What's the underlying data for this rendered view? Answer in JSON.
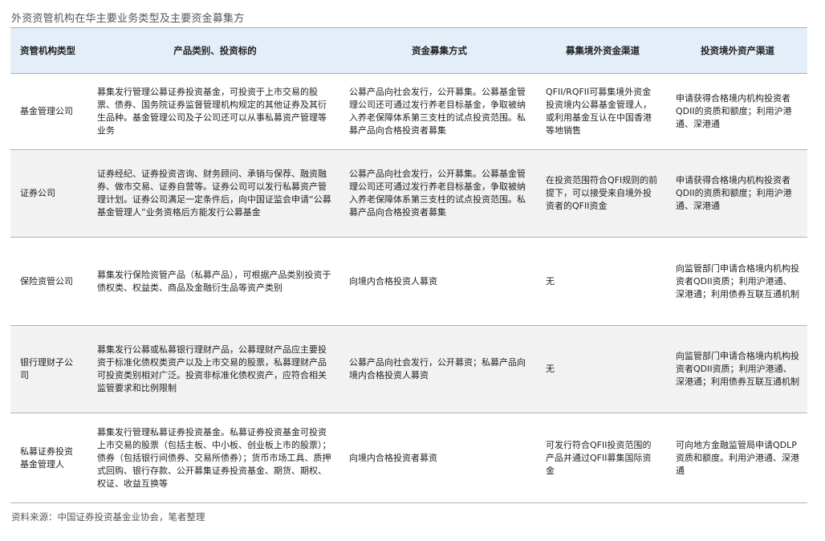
{
  "title": "外资资管机构在华主要业务类型及主要资金募集方",
  "headers": [
    "资管机构类型",
    "产品类别、投资标的",
    "资金募集方式",
    "募集境外资金渠道",
    "投资境外资产渠道"
  ],
  "rows": [
    {
      "type": "基金管理公司",
      "products": "募集发行管理公募证券投资基金，可投资于上市交易的股票、债券、国务院证券监督管理机构规定的其他证券及其衍生品种。基金管理公司及子公司还可以从事私募资产管理等业务",
      "fundraising": "公募产品向社会发行，公开募集。公募基金管理公司还可通过发行养老目标基金，争取被纳入养老保障体系第三支柱的试点投资范围。私募产品向合格投资者募集",
      "overseas_funds": "QFII/RQFII可募集境外资金投资境内公募基金管理人，或利用基金互认在中国香港等地销售",
      "overseas_assets": "申请获得合格境内机构投资者QDII的资质和额度；利用沪港通、深港通"
    },
    {
      "type": "证券公司",
      "products": "证券经纪、证券投资咨询、财务顾问、承销与保荐、融资融券、做市交易、证券自营等。证券公司可以发行私募资产管理计划。证券公司满足一定条件后，向中国证监会申请“公募基金管理人”业务资格后方能发行公募基金",
      "fundraising": "公募产品向社会发行，公开募集。公募基金管理公司还可通过发行养老目标基金，争取被纳入养老保障体系第三支柱的试点投资范围。私募产品向合格投资者募集",
      "overseas_funds": "在投资范围符合QFI规则的前提下，可以接受来自境外投资者的QFII资金",
      "overseas_assets": "申请获得合格境内机构投资者QDII的资质和额度；利用沪港通、深港通"
    },
    {
      "type": "保险资管公司",
      "products": "募集发行保险资管产品（私募产品），可根据产品类别投资于债权类、权益类、商品及金融衍生品等资产类别",
      "fundraising": "向境内合格投资人募资",
      "overseas_funds": "无",
      "overseas_assets": "向监管部门申请合格境内机构投资者QDII资质；利用沪港通、深港通；利用债券互联互通机制"
    },
    {
      "type": "银行理财子公司",
      "products": "募集发行公募或私募银行理财产品，公募理财产品应主要投资于标准化债权类资产以及上市交易的股票，私募理财产品可投资类别相对广泛。投资非标准化债权资产，应符合相关监管要求和比例限制",
      "fundraising": "公募产品向社会发行，公开募资；私募产品向境内合格投资人募资",
      "overseas_funds": "无",
      "overseas_assets": "向监管部门申请合格境内机构投资者QDII资质；利用沪港通、深港通；利用债券互联互通机制"
    },
    {
      "type": "私募证券投资基金管理人",
      "products": "募集发行管理私募证券投资基金。私募证券投资基金可投资上市交易的股票（包括主板、中小板、创业板上市的股票）；债券（包括银行间债券、交易所债券）；货币市场工具、质押式回购、银行存款、公开募集证券投资基金、期货、期权、权证、收益互换等",
      "fundraising": "向境内合格投资者募资",
      "overseas_funds": "可发行符合QFII投资范围的产品并通过QFII募集国际资金",
      "overseas_assets": "可向地方金融监管局申请QDLP资质和额度。利用沪港通、深港通"
    }
  ],
  "source": "资料来源：中国证券投资基金业协会，笔者整理"
}
